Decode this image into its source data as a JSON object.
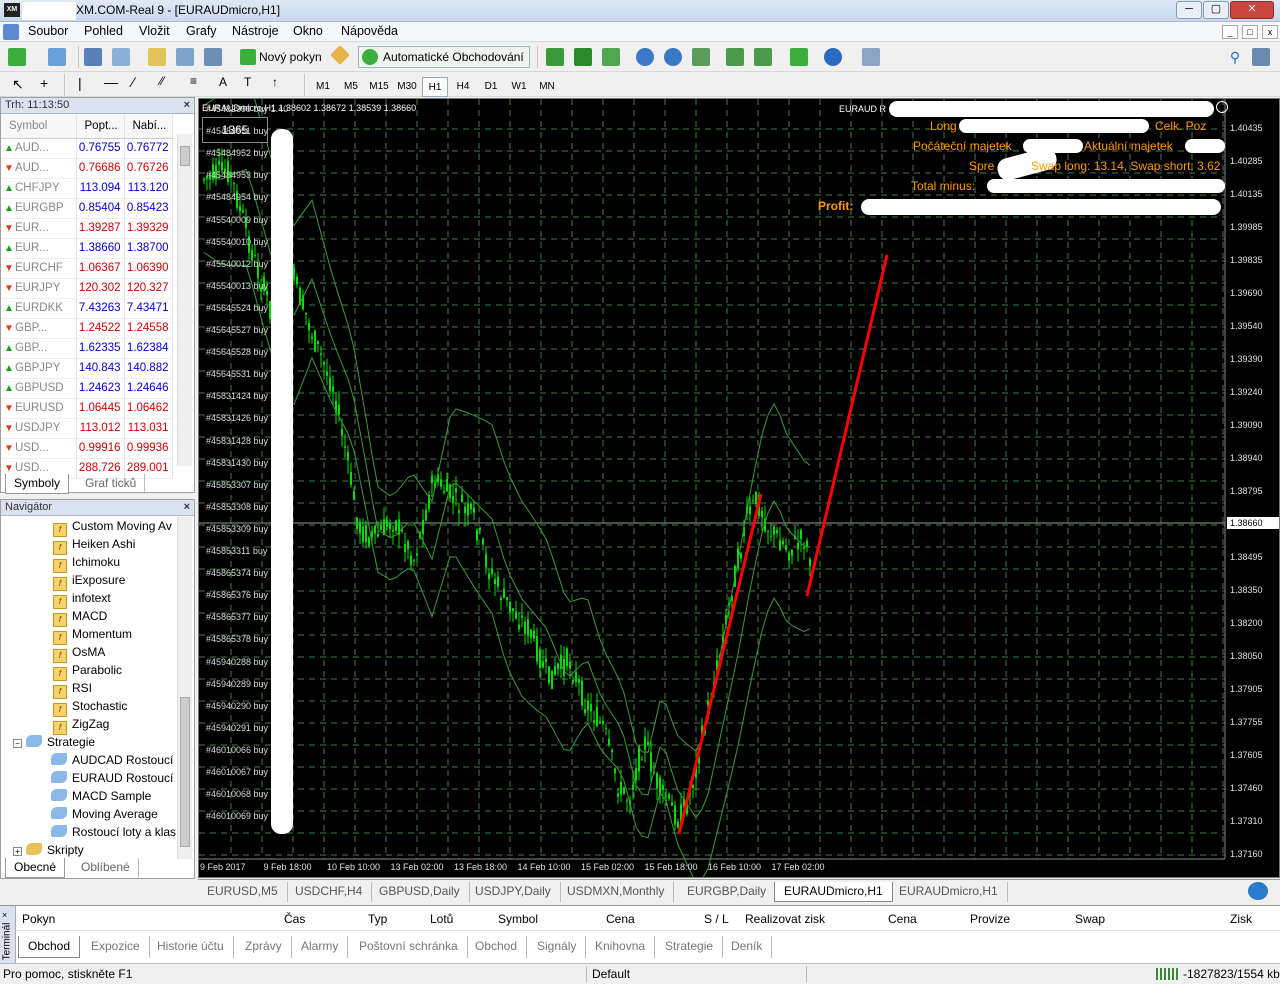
{
  "window": {
    "title": "XM.COM-Real 9 - [EURAUDmicro,H1]",
    "app_icon": "XM"
  },
  "menu": [
    "Soubor",
    "Pohled",
    "Vložit",
    "Grafy",
    "Nástroje",
    "Okno",
    "Nápověda"
  ],
  "toolbar": {
    "new_order": "Nový pokyn",
    "auto_trading": "Automatické Obchodování"
  },
  "timeframes": [
    "M1",
    "M5",
    "M15",
    "M30",
    "H1",
    "H4",
    "D1",
    "W1",
    "MN"
  ],
  "active_timeframe": "H1",
  "market_watch": {
    "title": "Trh: 11:13:50",
    "headers": [
      "Symbol",
      "Popt...",
      "Nabí..."
    ],
    "rows": [
      {
        "symbol": "AUD...",
        "bid": "0.76755",
        "ask": "0.76772",
        "dir": "up"
      },
      {
        "symbol": "AUD...",
        "bid": "0.76686",
        "ask": "0.76726",
        "dir": "down"
      },
      {
        "symbol": "CHFJPY",
        "bid": "113.094",
        "ask": "113.120",
        "dir": "up"
      },
      {
        "symbol": "EURGBP",
        "bid": "0.85404",
        "ask": "0.85423",
        "dir": "up"
      },
      {
        "symbol": "EUR...",
        "bid": "1.39287",
        "ask": "1.39329",
        "dir": "down"
      },
      {
        "symbol": "EUR...",
        "bid": "1.38660",
        "ask": "1.38700",
        "dir": "up"
      },
      {
        "symbol": "EURCHF",
        "bid": "1.06367",
        "ask": "1.06390",
        "dir": "down"
      },
      {
        "symbol": "EURJPY",
        "bid": "120.302",
        "ask": "120.327",
        "dir": "down"
      },
      {
        "symbol": "EURDKK",
        "bid": "7.43263",
        "ask": "7.43471",
        "dir": "up"
      },
      {
        "symbol": "GBP...",
        "bid": "1.24522",
        "ask": "1.24558",
        "dir": "down"
      },
      {
        "symbol": "GBP...",
        "bid": "1.62335",
        "ask": "1.62384",
        "dir": "up"
      },
      {
        "symbol": "GBPJPY",
        "bid": "140.843",
        "ask": "140.882",
        "dir": "up"
      },
      {
        "symbol": "GBPUSD",
        "bid": "1.24623",
        "ask": "1.24646",
        "dir": "up"
      },
      {
        "symbol": "EURUSD",
        "bid": "1.06445",
        "ask": "1.06462",
        "dir": "down"
      },
      {
        "symbol": "USDJPY",
        "bid": "113.012",
        "ask": "113.031",
        "dir": "down"
      },
      {
        "symbol": "USD...",
        "bid": "0.99916",
        "ask": "0.99936",
        "dir": "down"
      },
      {
        "symbol": "USD...",
        "bid": "288.726",
        "ask": "289.001",
        "dir": "down"
      }
    ],
    "tabs": [
      "Symboly",
      "Graf ticků"
    ]
  },
  "navigator": {
    "title": "Navigátor",
    "indicators": [
      "Custom Moving Av",
      "Heiken Ashi",
      "Ichimoku",
      "iExposure",
      "infotext",
      "MACD",
      "Momentum",
      "OsMA",
      "Parabolic",
      "RSI",
      "Stochastic",
      "ZigZag"
    ],
    "strategies_label": "Strategie",
    "strategies": [
      "AUDCAD Rostoucí",
      "EURAUD Rostoucí l",
      "MACD Sample",
      "Moving Average",
      "Rostoucí loty a klas"
    ],
    "scripts_label": "Skripty",
    "tabs": [
      "Obecné",
      "Oblíbené"
    ]
  },
  "chart": {
    "header": "EURAUDmicro,H1  1.38602 1.38672 1.38539 1.38660",
    "counter": "1365",
    "ea_title": "EURAUD R",
    "info_lines": {
      "long": "Long",
      "total_pos": "Celk. Poz",
      "start_equity": "Počáteční majetek",
      "current_equity": "Aktuální majetek",
      "spread": "Spre",
      "swap": "Swap long: 13.14, Swap short: 3.62",
      "total_minus": "Total minus:",
      "profit": "Profit:"
    },
    "current_price": "1.38660",
    "price_labels": [
      "1.40435",
      "1.40285",
      "1.40135",
      "1.39985",
      "1.39835",
      "1.39690",
      "1.39540",
      "1.39390",
      "1.39240",
      "1.39090",
      "1.38940",
      "1.38795",
      "1.38645",
      "1.38495",
      "1.38350",
      "1.38200",
      "1.38050",
      "1.37905",
      "1.37755",
      "1.37605",
      "1.37460",
      "1.37310",
      "1.37160"
    ],
    "time_labels": [
      "9 Feb 2017",
      "9 Feb 18:00",
      "10 Feb 10:00",
      "13 Feb 02:00",
      "13 Feb 18:00",
      "14 Feb 10:00",
      "15 Feb 02:00",
      "15 Feb 18:00",
      "16 Feb 10:00",
      "17 Feb 02:00"
    ],
    "orders": [
      "#45482999 buy 1.40",
      "#45484951 buy",
      "#45484952 buy",
      "#45484953 buy",
      "#45484954 buy",
      "#45540009 buy",
      "#45540010 buy",
      "#45540012 buy",
      "#45540013 buy",
      "#45645524 buy",
      "#45645527 buy",
      "#45645528 buy",
      "#45645531 buy",
      "#45831424 buy",
      "#45831426 buy",
      "#45831428 buy",
      "#45831430 buy",
      "#45853307 buy",
      "#45853308 buy",
      "#45853309 buy",
      "#45853311 buy",
      "#45865374 buy",
      "#45865376 buy",
      "#45865377 buy",
      "#45865378 buy",
      "#45940288 buy",
      "#45940289 buy",
      "#45940290 buy",
      "#45940291 buy",
      "#46010066 buy",
      "#46010067 buy",
      "#46010068 buy",
      "#46010069 buy limit"
    ],
    "colors": {
      "bg": "#000000",
      "candle": "#00e000",
      "grid": "#4a7a4a",
      "trend": "#ff0000",
      "info": "#ff9a00"
    }
  },
  "chart_tabs": [
    "EURUSD,M5",
    "USDCHF,H4",
    "GBPUSD,Daily",
    "USDJPY,Daily",
    "USDMXN,Monthly",
    "EURGBP,Daily",
    "EURAUDmicro,H1",
    "EURAUDmicro,H1"
  ],
  "active_chart_tab": 6,
  "terminal": {
    "side_label": "Terminál",
    "headers": [
      "Pokyn",
      "Čas",
      "Typ",
      "Lotů",
      "Symbol",
      "Cena",
      "S / L",
      "Realizovat zisk",
      "Cena",
      "Provize",
      "Swap",
      "Zisk"
    ],
    "tabs": [
      "Obchod",
      "Expozice",
      "Historie účtu",
      "Zprávy",
      "Alarmy",
      "Poštovní schránka",
      "Obchod",
      "Signály",
      "Knihovna",
      "Strategie",
      "Deník"
    ]
  },
  "status": {
    "help": "Pro pomoc, stiskněte F1",
    "profile": "Default",
    "traffic": "-1827823/1554 kb"
  }
}
